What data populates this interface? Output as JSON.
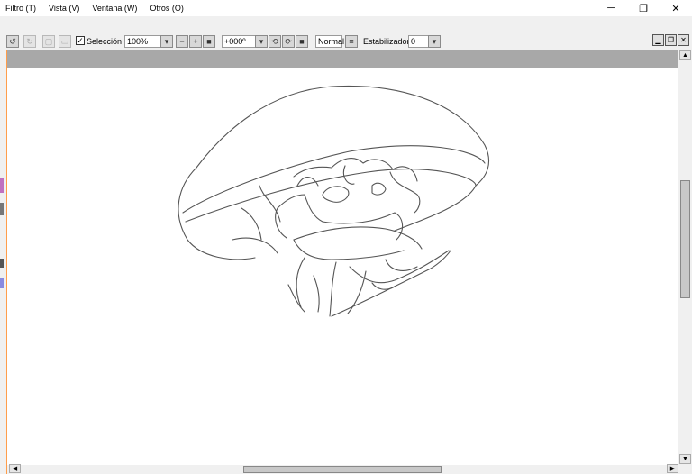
{
  "menu": {
    "items": [
      {
        "label": "Filtro (T)"
      },
      {
        "label": "Vista (V)"
      },
      {
        "label": "Ventana (W)"
      },
      {
        "label": "Otros (O)"
      }
    ]
  },
  "window": {
    "minimize_icon": "minimize-icon",
    "restore_icon": "restore-icon",
    "close_icon": "close-icon"
  },
  "toolbar": {
    "selection_label": "Selección",
    "selection_checked": true,
    "zoom_value": "100%",
    "rotation_value": "+000º",
    "blend_mode": "Normal",
    "stabilizer_label": "Estabilizador",
    "stabilizer_value": "0"
  },
  "colors": {
    "accent_frame": "#ff9d4a",
    "toolbar_bg": "#f0f0f0",
    "canvas_header": "#a8a8a8"
  }
}
